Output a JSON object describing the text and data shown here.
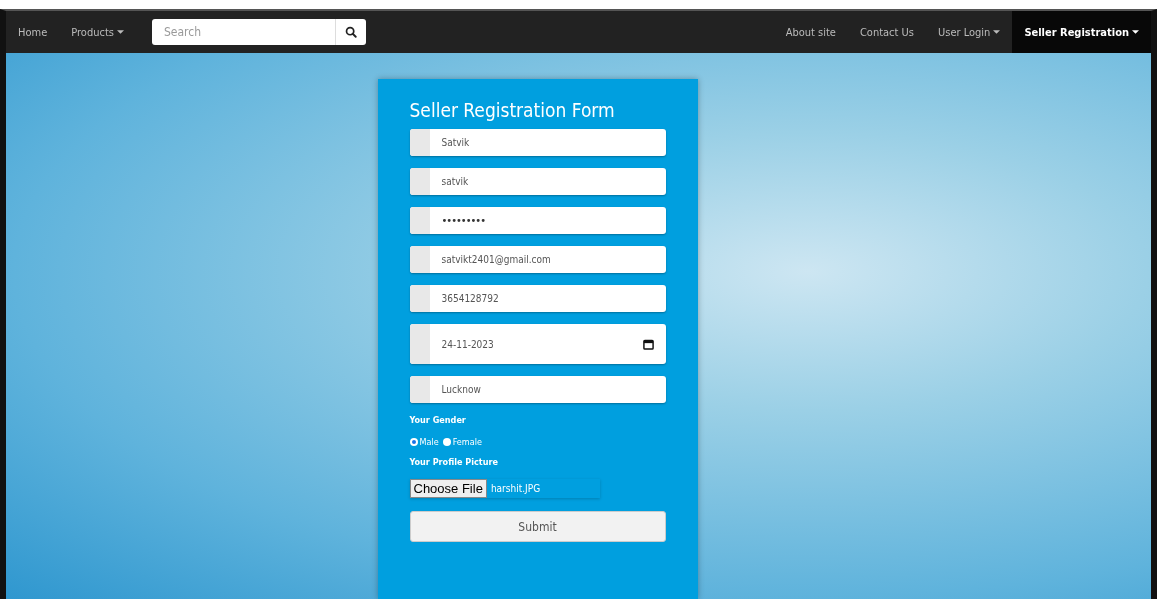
{
  "navbar": {
    "left": [
      {
        "label": "Home",
        "dropdown": false
      },
      {
        "label": "Products",
        "dropdown": true
      }
    ],
    "search": {
      "placeholder": "Search"
    },
    "right": [
      {
        "label": "About site",
        "dropdown": false,
        "selected": false
      },
      {
        "label": "Contact Us",
        "dropdown": false,
        "selected": false
      },
      {
        "label": "User Login",
        "dropdown": true,
        "selected": false
      },
      {
        "label": "Seller Registration",
        "dropdown": true,
        "selected": true
      }
    ]
  },
  "form": {
    "title": "Seller Registration Form",
    "fields": [
      {
        "kind": "text",
        "value": "Satvik"
      },
      {
        "kind": "text",
        "value": "satvik"
      },
      {
        "kind": "password",
        "value": "•••••••••"
      },
      {
        "kind": "text",
        "value": "satvikt2401@gmail.com"
      },
      {
        "kind": "text",
        "value": "3654128792"
      },
      {
        "kind": "date",
        "value": "24-11-2023"
      },
      {
        "kind": "text",
        "value": "Lucknow"
      }
    ],
    "gender_label": "Your Gender",
    "gender_options": [
      {
        "label": "Male",
        "selected": true
      },
      {
        "label": "Female",
        "selected": false
      }
    ],
    "picture_label": "Your Profile Picture",
    "file_button": "Choose File",
    "file_name": "harshit.JPG",
    "submit": "Submit"
  }
}
